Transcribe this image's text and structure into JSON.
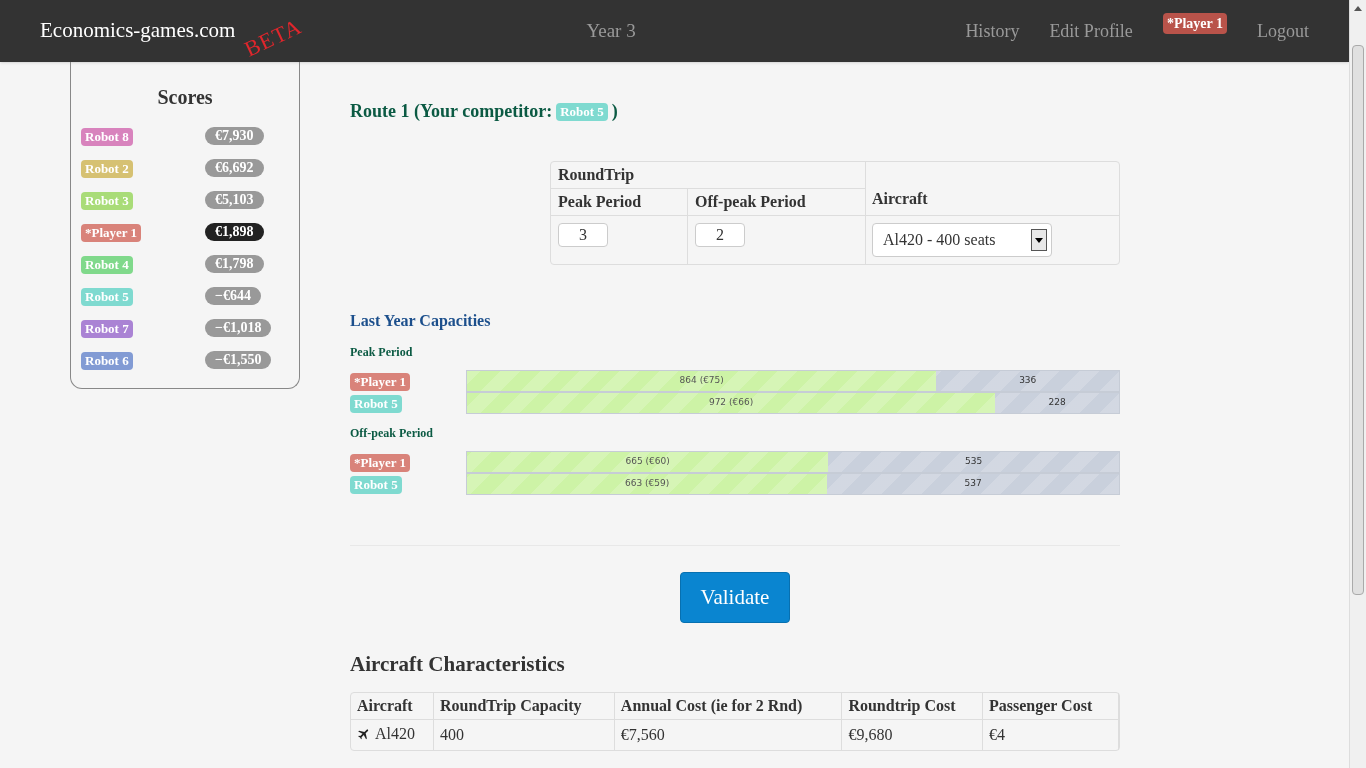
{
  "navbar": {
    "brand": "Economics-games.com",
    "beta": "BETA",
    "center": "Year 3",
    "links": [
      "History",
      "Edit Profile"
    ],
    "user_badge": "*Player 1",
    "logout": "Logout"
  },
  "scores": {
    "title": "Scores",
    "items": [
      {
        "name": "Robot 8",
        "color": "#d883bd",
        "score": "€7,930",
        "current": false
      },
      {
        "name": "Robot 2",
        "color": "#d6c172",
        "score": "€6,692",
        "current": false
      },
      {
        "name": "Robot 3",
        "color": "#a9dc78",
        "score": "€5,103",
        "current": false
      },
      {
        "name": "*Player 1",
        "color": "#d9837a",
        "score": "€1,898",
        "current": true
      },
      {
        "name": "Robot 4",
        "color": "#80d98b",
        "score": "€1,798",
        "current": false
      },
      {
        "name": "Robot 5",
        "color": "#7fdad0",
        "score": "−€644",
        "current": false
      },
      {
        "name": "Robot 7",
        "color": "#aa83d4",
        "score": "−€1,018",
        "current": false
      },
      {
        "name": "Robot 6",
        "color": "#829bd4",
        "score": "−€1,550",
        "current": false
      }
    ]
  },
  "route": {
    "heading": "Route 1 (Your competitor:",
    "competitor": {
      "name": "Robot 5",
      "color": "#7fdad0"
    },
    "heading_end": ")"
  },
  "decision_table": {
    "group_header": "RoundTrip",
    "columns": [
      "Peak Period",
      "Off-peak Period",
      "Aircraft"
    ],
    "peak_value": "3",
    "offpeak_value": "2",
    "aircraft_value": "Al420 - 400 seats"
  },
  "capacities": {
    "title": "Last Year Capacities",
    "periods": [
      {
        "title": "Peak Period",
        "rows": [
          {
            "player": "*Player 1",
            "color": "#d9837a",
            "level": 0.72,
            "used": "864 (€75)",
            "free": "336"
          },
          {
            "player": "Robot 5",
            "color": "#7fdad0",
            "level": 0.81,
            "used": "972 (€66)",
            "free": "228"
          }
        ]
      },
      {
        "title": "Off-peak Period",
        "rows": [
          {
            "player": "*Player 1",
            "color": "#d9837a",
            "level": 0.554,
            "used": "665 (€60)",
            "free": "535"
          },
          {
            "player": "Robot 5",
            "color": "#7fdad0",
            "level": 0.5525,
            "used": "663 (€59)",
            "free": "537"
          }
        ]
      }
    ]
  },
  "validate_button": "Validate",
  "aircraft_characteristics": {
    "title": "Aircraft Characteristics",
    "columns": [
      "Aircraft",
      "RoundTrip Capacity",
      "Annual Cost (ie for 2 Rnd)",
      "Roundtrip Cost",
      "Passenger Cost"
    ],
    "rows": [
      [
        "Al420",
        "400",
        "€7,560",
        "€9,680",
        "€4"
      ]
    ]
  }
}
